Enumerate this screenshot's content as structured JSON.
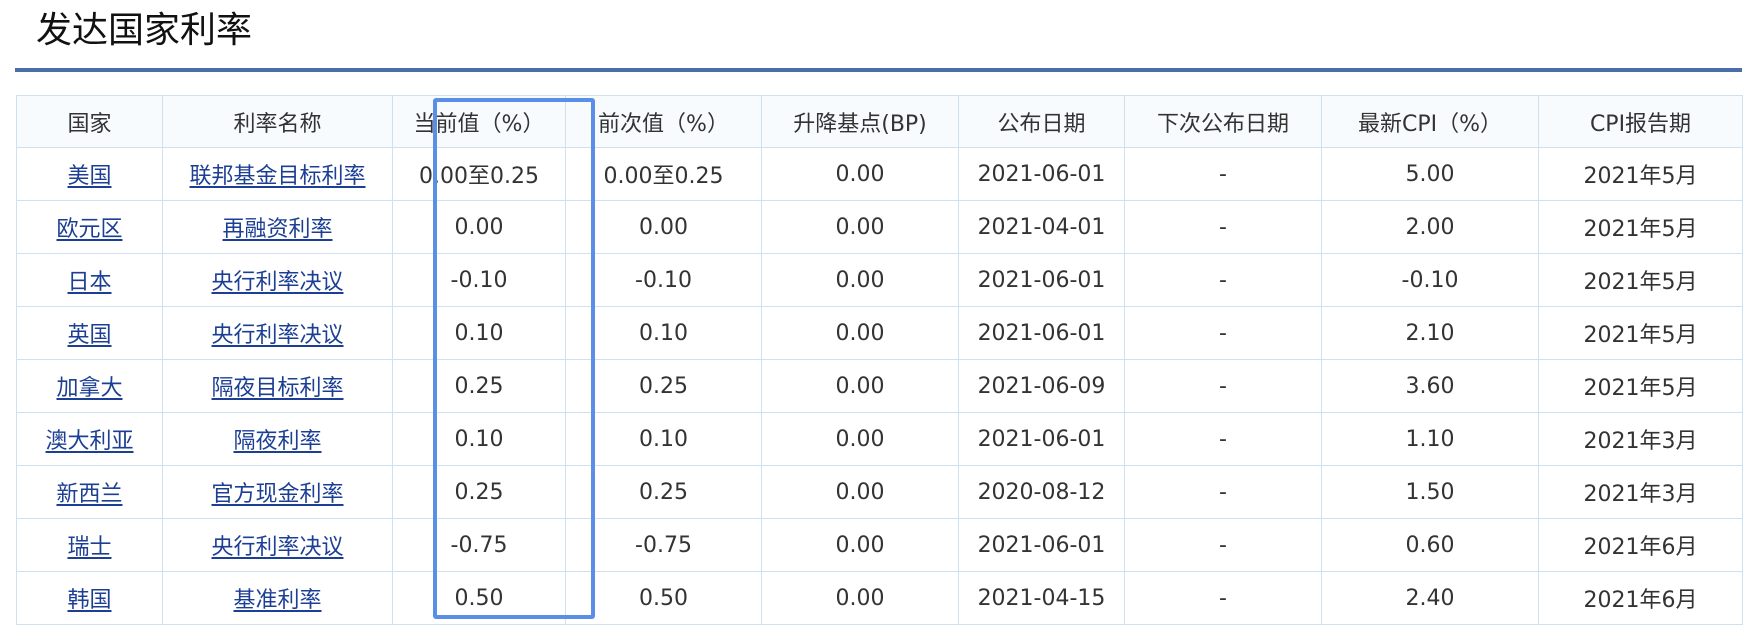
{
  "page": {
    "title": "发达国家利率"
  },
  "table": {
    "headers": {
      "country": "国家",
      "rate_name": "利率名称",
      "current": "当前值（%）",
      "previous": "前次值（%）",
      "change_bp": "升降基点(BP)",
      "publish_date": "公布日期",
      "next_date": "下次公布日期",
      "latest_cpi": "最新CPI（%）",
      "cpi_period": "CPI报告期"
    },
    "rows": [
      {
        "country": "美国",
        "rate_name": "联邦基金目标利率",
        "current": "0.00至0.25",
        "previous": "0.00至0.25",
        "change_bp": "0.00",
        "publish_date": "2021-06-01",
        "next_date": "-",
        "latest_cpi": "5.00",
        "cpi_period": "2021年5月"
      },
      {
        "country": "欧元区",
        "rate_name": "再融资利率",
        "current": "0.00",
        "previous": "0.00",
        "change_bp": "0.00",
        "publish_date": "2021-04-01",
        "next_date": "-",
        "latest_cpi": "2.00",
        "cpi_period": "2021年5月"
      },
      {
        "country": "日本",
        "rate_name": "央行利率决议",
        "current": "-0.10",
        "previous": "-0.10",
        "change_bp": "0.00",
        "publish_date": "2021-06-01",
        "next_date": "-",
        "latest_cpi": "-0.10",
        "cpi_period": "2021年5月"
      },
      {
        "country": "英国",
        "rate_name": "央行利率决议",
        "current": "0.10",
        "previous": "0.10",
        "change_bp": "0.00",
        "publish_date": "2021-06-01",
        "next_date": "-",
        "latest_cpi": "2.10",
        "cpi_period": "2021年5月"
      },
      {
        "country": "加拿大",
        "rate_name": "隔夜目标利率",
        "current": "0.25",
        "previous": "0.25",
        "change_bp": "0.00",
        "publish_date": "2021-06-09",
        "next_date": "-",
        "latest_cpi": "3.60",
        "cpi_period": "2021年5月"
      },
      {
        "country": "澳大利亚",
        "rate_name": "隔夜利率",
        "current": "0.10",
        "previous": "0.10",
        "change_bp": "0.00",
        "publish_date": "2021-06-01",
        "next_date": "-",
        "latest_cpi": "1.10",
        "cpi_period": "2021年3月"
      },
      {
        "country": "新西兰",
        "rate_name": "官方现金利率",
        "current": "0.25",
        "previous": "0.25",
        "change_bp": "0.00",
        "publish_date": "2020-08-12",
        "next_date": "-",
        "latest_cpi": "1.50",
        "cpi_period": "2021年3月"
      },
      {
        "country": "瑞士",
        "rate_name": "央行利率决议",
        "current": "-0.75",
        "previous": "-0.75",
        "change_bp": "0.00",
        "publish_date": "2021-06-01",
        "next_date": "-",
        "latest_cpi": "0.60",
        "cpi_period": "2021年6月"
      },
      {
        "country": "韩国",
        "rate_name": "基准利率",
        "current": "0.50",
        "previous": "0.50",
        "change_bp": "0.00",
        "publish_date": "2021-04-15",
        "next_date": "-",
        "latest_cpi": "2.40",
        "cpi_period": "2021年6月"
      }
    ]
  },
  "colors": {
    "title_rule": "#4a6ea9",
    "link": "#1c3f95",
    "grid_border": "#cfe0ee",
    "highlight_box": "#5b8ee6"
  }
}
